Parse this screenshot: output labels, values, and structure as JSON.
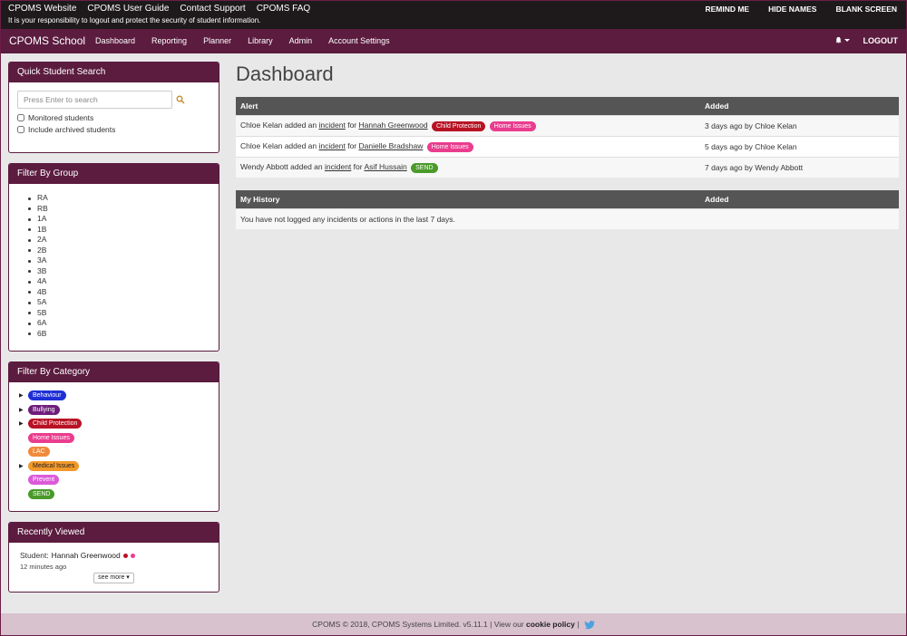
{
  "colors": {
    "brand": "#5b1c3f",
    "topbar": "#1e1a1c",
    "table_header": "#555555",
    "behaviour": "#1f2fd6",
    "bullying": "#6e1e7a",
    "child_protection": "#b81224",
    "home_issues": "#ea3d8e",
    "lac": "#f08a3a",
    "medical_issues": "#f3982b",
    "prevent": "#dc5ad9",
    "send": "#4a9a2a"
  },
  "topbar": {
    "links": [
      "CPOMS Website",
      "CPOMS User Guide",
      "Contact Support",
      "CPOMS FAQ"
    ],
    "note": "It is your responsibility to logout and protect the security of student information.",
    "actions": [
      "REMIND ME",
      "HIDE NAMES",
      "BLANK SCREEN"
    ]
  },
  "nav": {
    "brand": "CPOMS School",
    "items": [
      "Dashboard",
      "Reporting",
      "Planner",
      "Library",
      "Admin",
      "Account Settings"
    ],
    "logout": "LOGOUT"
  },
  "quick_search": {
    "title": "Quick Student Search",
    "placeholder": "Press Enter to search",
    "monitored": "Monitored students",
    "archived": "Include archived students"
  },
  "filter_group": {
    "title": "Filter By Group",
    "groups": [
      "RA",
      "RB",
      "1A",
      "1B",
      "2A",
      "2B",
      "3A",
      "3B",
      "4A",
      "4B",
      "5A",
      "5B",
      "6A",
      "6B"
    ]
  },
  "filter_category": {
    "title": "Filter By Category",
    "categories": [
      "Behaviour",
      "Bullying",
      "Child Protection",
      "Home Issues",
      "LAC",
      "Medical Issues",
      "Prevent",
      "SEND"
    ]
  },
  "recent": {
    "title": "Recently Viewed",
    "prefix": "Student:",
    "name": "Hannah Greenwood",
    "time": "12 minutes ago",
    "see_more": "see more ▾"
  },
  "dashboard": {
    "title": "Dashboard",
    "alerts_header": "Alert",
    "added_header": "Added",
    "alerts": [
      {
        "actor": "Chloe Kelan",
        "verb": "added an",
        "link": "incident",
        "for": "for",
        "student": "Hannah Greenwood",
        "tags": [
          "Child Protection",
          "Home Issues"
        ],
        "added": "3 days ago by Chloe Kelan"
      },
      {
        "actor": "Chloe Kelan",
        "verb": "added an",
        "link": "incident",
        "for": "for",
        "student": "Danielle Bradshaw",
        "tags": [
          "Home Issues"
        ],
        "added": "5 days ago by Chloe Kelan"
      },
      {
        "actor": "Wendy Abbott",
        "verb": "added an",
        "link": "incident",
        "for": "for",
        "student": "Asif Hussain",
        "tags": [
          "SEND"
        ],
        "added": "7 days ago by Wendy Abbott"
      }
    ],
    "history_header": "My History",
    "history_added_header": "Added",
    "history_empty": "You have not logged any incidents or actions in the last 7 days."
  },
  "footer": {
    "text": "CPOMS © 2018, CPOMS Systems Limited. v5.11.1 | View our",
    "cookie": "cookie policy",
    "sep": "|"
  }
}
